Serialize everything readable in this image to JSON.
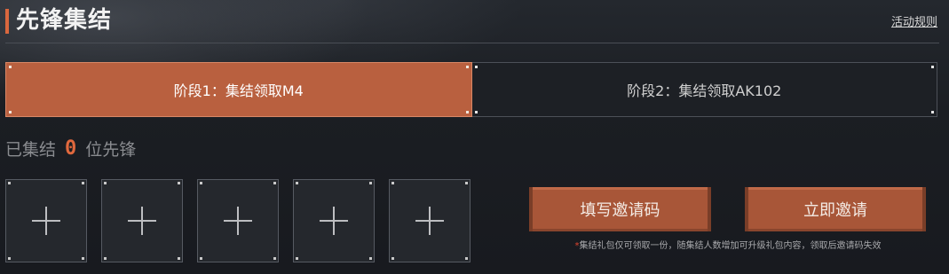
{
  "header": {
    "title": "先锋集结",
    "rules_link": "活动规则"
  },
  "tabs": [
    {
      "label": "阶段1：集结领取M4",
      "active": true
    },
    {
      "label": "阶段2：集结领取AK102",
      "active": false
    }
  ],
  "gathered": {
    "prefix": "已集结",
    "count": "0",
    "suffix": "位先锋"
  },
  "slots": {
    "count": 5,
    "icon": "plus-icon"
  },
  "actions": {
    "fill_code": "填写邀请码",
    "invite_now": "立即邀请"
  },
  "notice": {
    "marker": "*",
    "text": "集结礼包仅可领取一份，随集结人数增加可升级礼包内容，领取后邀请码失效"
  },
  "colors": {
    "accent": "#d9673e",
    "active_tab": "#b9603f",
    "button": "#a85638",
    "background": "#1c1f24"
  }
}
